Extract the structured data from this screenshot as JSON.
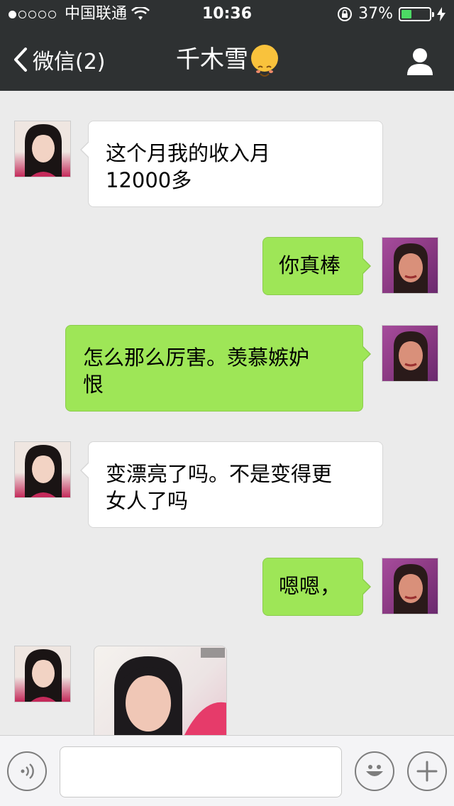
{
  "status": {
    "carrier": "中国联通",
    "time": "10:36",
    "battery_text": "37%",
    "battery_level": 0.37
  },
  "nav": {
    "back_label": "微信(2)",
    "title": "千木雪"
  },
  "messages": [
    {
      "side": "in",
      "text": "这个月我的收入月\n12000多"
    },
    {
      "side": "out",
      "text": "你真棒"
    },
    {
      "side": "out",
      "text": "怎么那么厉害。羡慕嫉妒\n恨"
    },
    {
      "side": "in",
      "text": "变漂亮了吗。不是变得更\n女人了吗"
    },
    {
      "side": "out",
      "text": "嗯嗯，"
    },
    {
      "side": "in",
      "type": "image",
      "description": "photo"
    }
  ],
  "input": {
    "value": "",
    "placeholder": ""
  },
  "icons": {
    "voice": "voice-icon",
    "emoji": "emoji-icon",
    "more": "plus-icon",
    "profile": "profile-icon",
    "back": "chevron-left-icon"
  },
  "colors": {
    "header_bg": "#2e3132",
    "chat_bg": "#ebebeb",
    "out_bubble": "#9ee657",
    "in_bubble": "#ffffff",
    "battery_fill": "#4cd964"
  }
}
